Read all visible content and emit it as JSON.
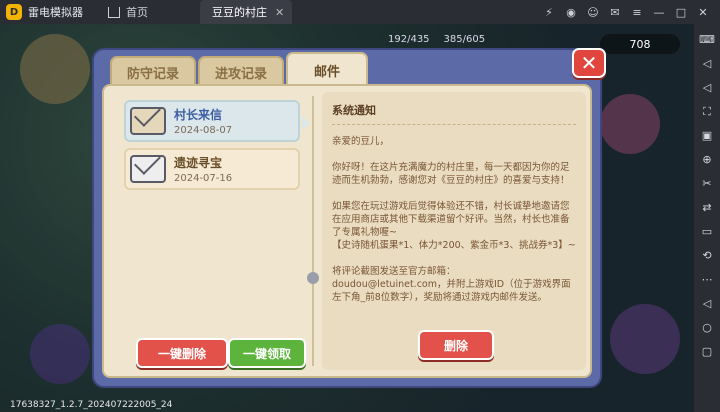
{
  "emulator": {
    "app_title": "雷电模拟器",
    "tabs": [
      {
        "label": "首页"
      },
      {
        "label": "豆豆的村庄"
      }
    ]
  },
  "game": {
    "stats": [
      "192/435",
      "385/605"
    ],
    "gems": "708",
    "build_id": "17638327_1.2.7_202407222005_24"
  },
  "mail_dialog": {
    "tabs": {
      "defense": "防守记录",
      "attack": "进攻记录",
      "mail": "邮件"
    },
    "close_label": "✕",
    "mails": [
      {
        "title": "村长来信",
        "date": "2024-08-07"
      },
      {
        "title": "遗迹寻宝",
        "date": "2024-07-16"
      }
    ],
    "buttons": {
      "delete_all": "一键删除",
      "claim_all": "一键领取",
      "delete": "删除"
    },
    "body": {
      "sender": "系统通知",
      "content": "亲爱的豆儿，\n\n你好呀！在这片充满魔力的村庄里，每一天都因为你的足迹而生机勃勃，感谢您对《豆豆的村庄》的喜爱与支持！\n\n如果您在玩过游戏后觉得体验还不错，村长诚挚地邀请您在应用商店或其他下载渠道留个好评。当然，村长也准备了专属礼物喔~\n【史诗随机蛋果*1、体力*200、紫金币*3、挑战券*3】~\n\n将评论截图发送至官方邮箱：\ndoudou@letuinet.com，并附上游戏ID（位于游戏界面左下角_前8位数字），奖励将通过游戏内邮件发送。"
    }
  }
}
